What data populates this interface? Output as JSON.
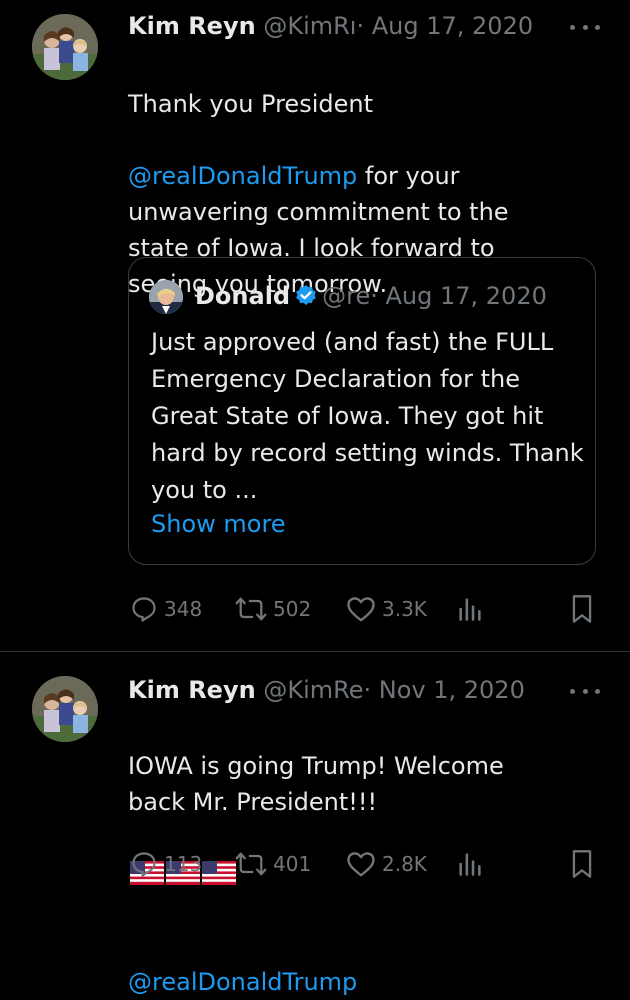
{
  "tweets": [
    {
      "author_name": "Kim Reyn",
      "author_handle": "@KimRı",
      "separator": "·",
      "date": "Aug 17, 2020",
      "text_before": "Thank you President",
      "mention": "@realDonaldTrump",
      "text_after": " for your unwavering commitment to the state of Iowa. I look forward to seeing you tomorrow.",
      "quote": {
        "author_name": "Donald",
        "author_handle": "@re",
        "separator": "·",
        "date": "Aug 17, 2020",
        "text": "Just approved (and fast) the FULL Emergency Declaration for the Great State of Iowa. They got hit hard by record setting winds. Thank you to ...",
        "show_more": "Show more"
      },
      "replies": "348",
      "reposts": "502",
      "likes": "3.3K"
    },
    {
      "author_name": "Kim Reyn",
      "author_handle": "@KimRe",
      "separator": "·",
      "date": "Nov 1, 2020",
      "text_before": "IOWA is going Trump! Welcome back Mr. President!!!",
      "mention": "@realDonaldTrump",
      "replies": "113",
      "reposts": "401",
      "likes": "2.8K"
    }
  ],
  "colors": {
    "background": "#000000",
    "text": "#e7e9ea",
    "muted": "#71767b",
    "link": "#1d9bf0",
    "verified": "#1d9bf0",
    "border": "#2f3336"
  },
  "icons": {
    "reply": "reply-icon",
    "repost": "repost-icon",
    "like": "heart-icon",
    "views": "views-icon",
    "bookmark": "bookmark-icon",
    "more": "more-dots-icon",
    "verified": "verified-badge-icon",
    "flag": "us-flag-emoji"
  }
}
